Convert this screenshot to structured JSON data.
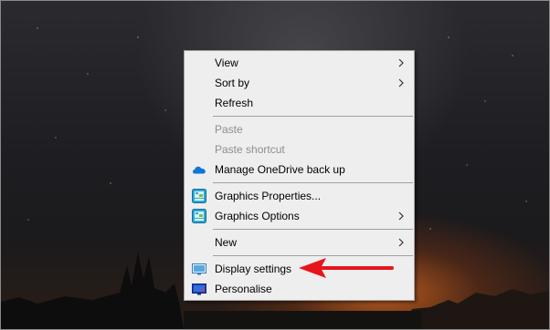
{
  "context_menu": {
    "items": [
      {
        "label": "View",
        "has_submenu": true,
        "disabled": false,
        "icon": ""
      },
      {
        "label": "Sort by",
        "has_submenu": true,
        "disabled": false,
        "icon": ""
      },
      {
        "label": "Refresh",
        "has_submenu": false,
        "disabled": false,
        "icon": ""
      },
      {
        "label": "Paste",
        "has_submenu": false,
        "disabled": true,
        "icon": ""
      },
      {
        "label": "Paste shortcut",
        "has_submenu": false,
        "disabled": true,
        "icon": ""
      },
      {
        "label": "Manage OneDrive back up",
        "has_submenu": false,
        "disabled": false,
        "icon": "onedrive-cloud-icon"
      },
      {
        "label": "Graphics Properties...",
        "has_submenu": false,
        "disabled": false,
        "icon": "intel-graphics-icon"
      },
      {
        "label": "Graphics Options",
        "has_submenu": true,
        "disabled": false,
        "icon": "intel-graphics-icon"
      },
      {
        "label": "New",
        "has_submenu": true,
        "disabled": false,
        "icon": ""
      },
      {
        "label": "Display settings",
        "has_submenu": false,
        "disabled": false,
        "icon": "display-settings-icon"
      },
      {
        "label": "Personalise",
        "has_submenu": false,
        "disabled": false,
        "icon": "personalise-icon"
      }
    ]
  },
  "annotation": {
    "arrow_color": "#e8141b",
    "arrow_target": "Display settings"
  },
  "colors": {
    "menu_background": "#eeeeee",
    "menu_border": "#a0a0a0",
    "disabled_text": "#8e8e8e",
    "onedrive_blue": "#0f78d4"
  }
}
